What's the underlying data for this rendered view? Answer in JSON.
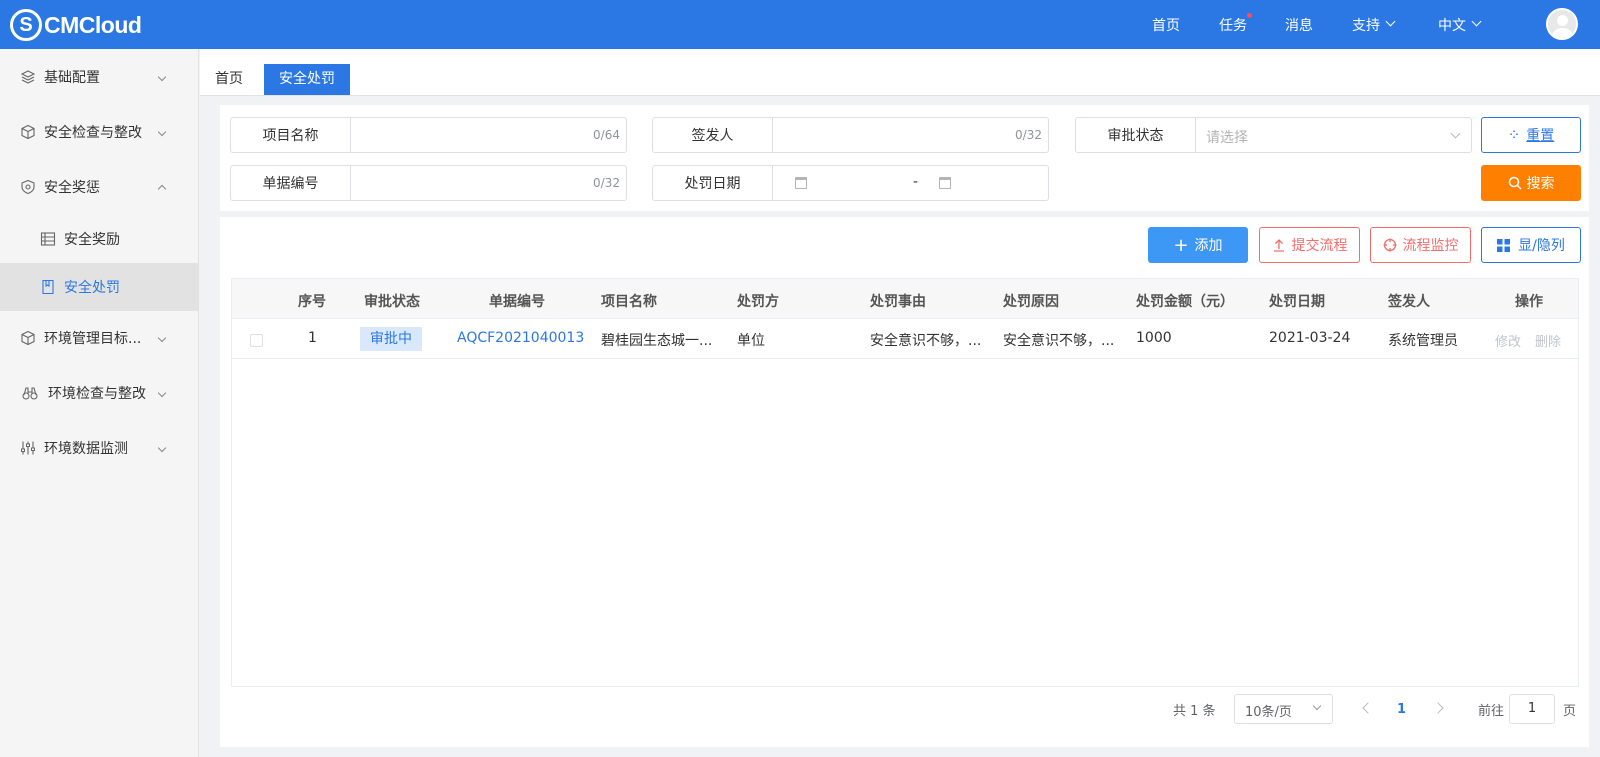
{
  "app": {
    "logo_letter": "S",
    "logo_text": "CMCloud"
  },
  "topnav": {
    "home": "首页",
    "tasks": "任务",
    "messages": "消息",
    "support": "支持",
    "language": "中文"
  },
  "sidebar": {
    "items": [
      {
        "label": "基础配置"
      },
      {
        "label": "安全检查与整改"
      },
      {
        "label": "安全奖惩"
      },
      {
        "label": "安全奖励"
      },
      {
        "label": "安全处罚"
      },
      {
        "label": "环境管理目标..."
      },
      {
        "label": "环境检查与整改"
      },
      {
        "label": "环境数据监测"
      }
    ]
  },
  "tabs": [
    {
      "label": "首页"
    },
    {
      "label": "安全处罚"
    }
  ],
  "filters": {
    "project_name": {
      "label": "项目名称",
      "counter": "0/64"
    },
    "issuer": {
      "label": "签发人",
      "counter": "0/32"
    },
    "approval_status": {
      "label": "审批状态",
      "placeholder": "请选择"
    },
    "doc_number": {
      "label": "单据编号",
      "counter": "0/32"
    },
    "penalty_date": {
      "label": "处罚日期",
      "separator": "-"
    },
    "reset_label": "重置",
    "search_label": "搜索"
  },
  "toolbar": {
    "add": "添加",
    "submit_flow": "提交流程",
    "flow_monitor": "流程监控",
    "toggle_columns": "显/隐列"
  },
  "table": {
    "headers": [
      "序号",
      "审批状态",
      "单据编号",
      "项目名称",
      "处罚方",
      "处罚事由",
      "处罚原因",
      "处罚金额（元）",
      "处罚日期",
      "签发人",
      "操作"
    ],
    "rows": [
      {
        "index": "1",
        "status": "审批中",
        "doc_no": "AQCF2021040013",
        "project": "碧桂园生态城一...",
        "party": "单位",
        "matter": "安全意识不够，...",
        "reason": "安全意识不够，...",
        "amount": "1000",
        "date": "2021-03-24",
        "issuer": "系统管理员",
        "edit": "修改",
        "delete": "删除"
      }
    ]
  },
  "pagination": {
    "total": "共 1 条",
    "page_size": "10条/页",
    "current": "1",
    "goto": "前往",
    "goto_value": "1",
    "page_suffix": "页"
  },
  "colors": {
    "primary": "#2b78e4",
    "orange": "#ff8000",
    "danger": "#f56c6c"
  }
}
